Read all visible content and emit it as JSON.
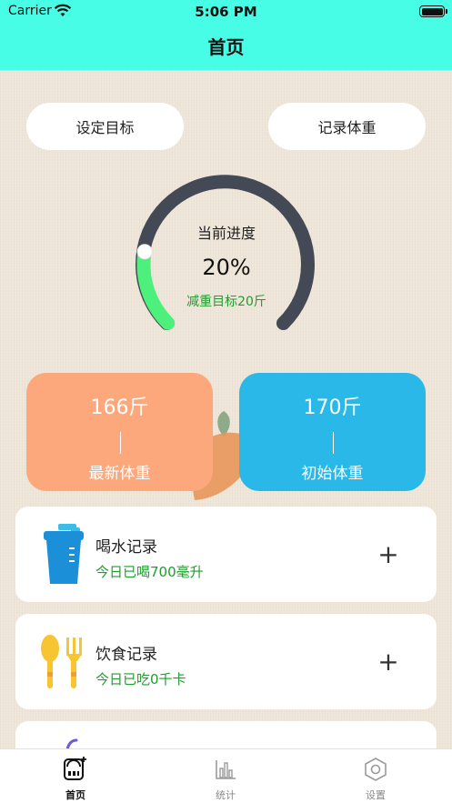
{
  "status_bar": {
    "carrier": "Carrier",
    "time": "5:06 PM"
  },
  "nav": {
    "title": "首页"
  },
  "buttons": {
    "set_goal": "设定目标",
    "record_weight": "记录体重"
  },
  "progress": {
    "label": "当前进度",
    "value_text": "20%",
    "fraction": 0.2,
    "goal_text": "减重目标20斤"
  },
  "weights": {
    "latest": {
      "value": "166斤",
      "label": "最新体重"
    },
    "initial": {
      "value": "170斤",
      "label": "初始体重"
    }
  },
  "records": [
    {
      "icon": "water-cup-icon",
      "title": "喝水记录",
      "subtitle": "今日已喝700毫升"
    },
    {
      "icon": "spoon-fork-icon",
      "title": "饮食记录",
      "subtitle": "今日已吃0千卡"
    }
  ],
  "tabs": [
    {
      "label": "首页",
      "icon": "scale-icon",
      "active": true
    },
    {
      "label": "统计",
      "icon": "bar-chart-icon",
      "active": false
    },
    {
      "label": "设置",
      "icon": "hexagon-settings-icon",
      "active": false
    }
  ],
  "colors": {
    "header": "#47fde6",
    "gauge_track": "#434955",
    "gauge_progress": "#4cf07a",
    "latest_card": "#fca87c",
    "initial_card": "#2ab8e8",
    "subtitle_green": "#1f9d2e"
  }
}
